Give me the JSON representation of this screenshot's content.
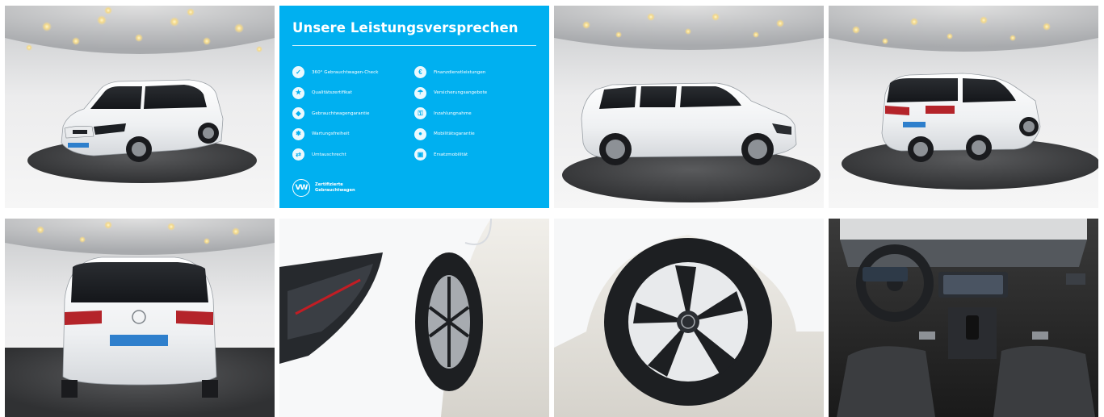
{
  "gallery": {
    "images": [
      {
        "name": "car-front-left-view"
      },
      {
        "name": "promo-card"
      },
      {
        "name": "car-side-view"
      },
      {
        "name": "car-rear-left-view"
      },
      {
        "name": "car-rear-view"
      },
      {
        "name": "headlight-detail"
      },
      {
        "name": "wheel-detail"
      },
      {
        "name": "interior-cockpit"
      }
    ]
  },
  "promo": {
    "title": "Unsere Leistungsversprechen",
    "left_items": [
      {
        "label": "360° Gebrauchtwagen-Check",
        "icon": "car-check-icon"
      },
      {
        "label": "Qualitätszertifikat",
        "icon": "certificate-icon"
      },
      {
        "label": "Gebrauchtwagengarantie",
        "icon": "shield-icon"
      },
      {
        "label": "Wartungsfreiheit",
        "icon": "wrench-icon"
      },
      {
        "label": "Umtauschrecht",
        "icon": "exchange-icon"
      }
    ],
    "right_items": [
      {
        "label": "Finanzdienstleistungen",
        "icon": "finance-icon"
      },
      {
        "label": "Versicherungsangebote",
        "icon": "insurance-icon"
      },
      {
        "label": "Inzahlungnahme",
        "icon": "key-icon"
      },
      {
        "label": "Mobilitätsgarantie",
        "icon": "mobility-icon"
      },
      {
        "label": "Ersatzmobilität",
        "icon": "replacement-car-icon"
      }
    ],
    "brand_line1": "Zertifizierte",
    "brand_line2": "Gebrauchtwagen",
    "brand_logo_text": "VW"
  },
  "colors": {
    "promo_bg": "#00b0f0",
    "car_white": "#f4f5f6",
    "showroom_floor": "#3a3a3c"
  }
}
